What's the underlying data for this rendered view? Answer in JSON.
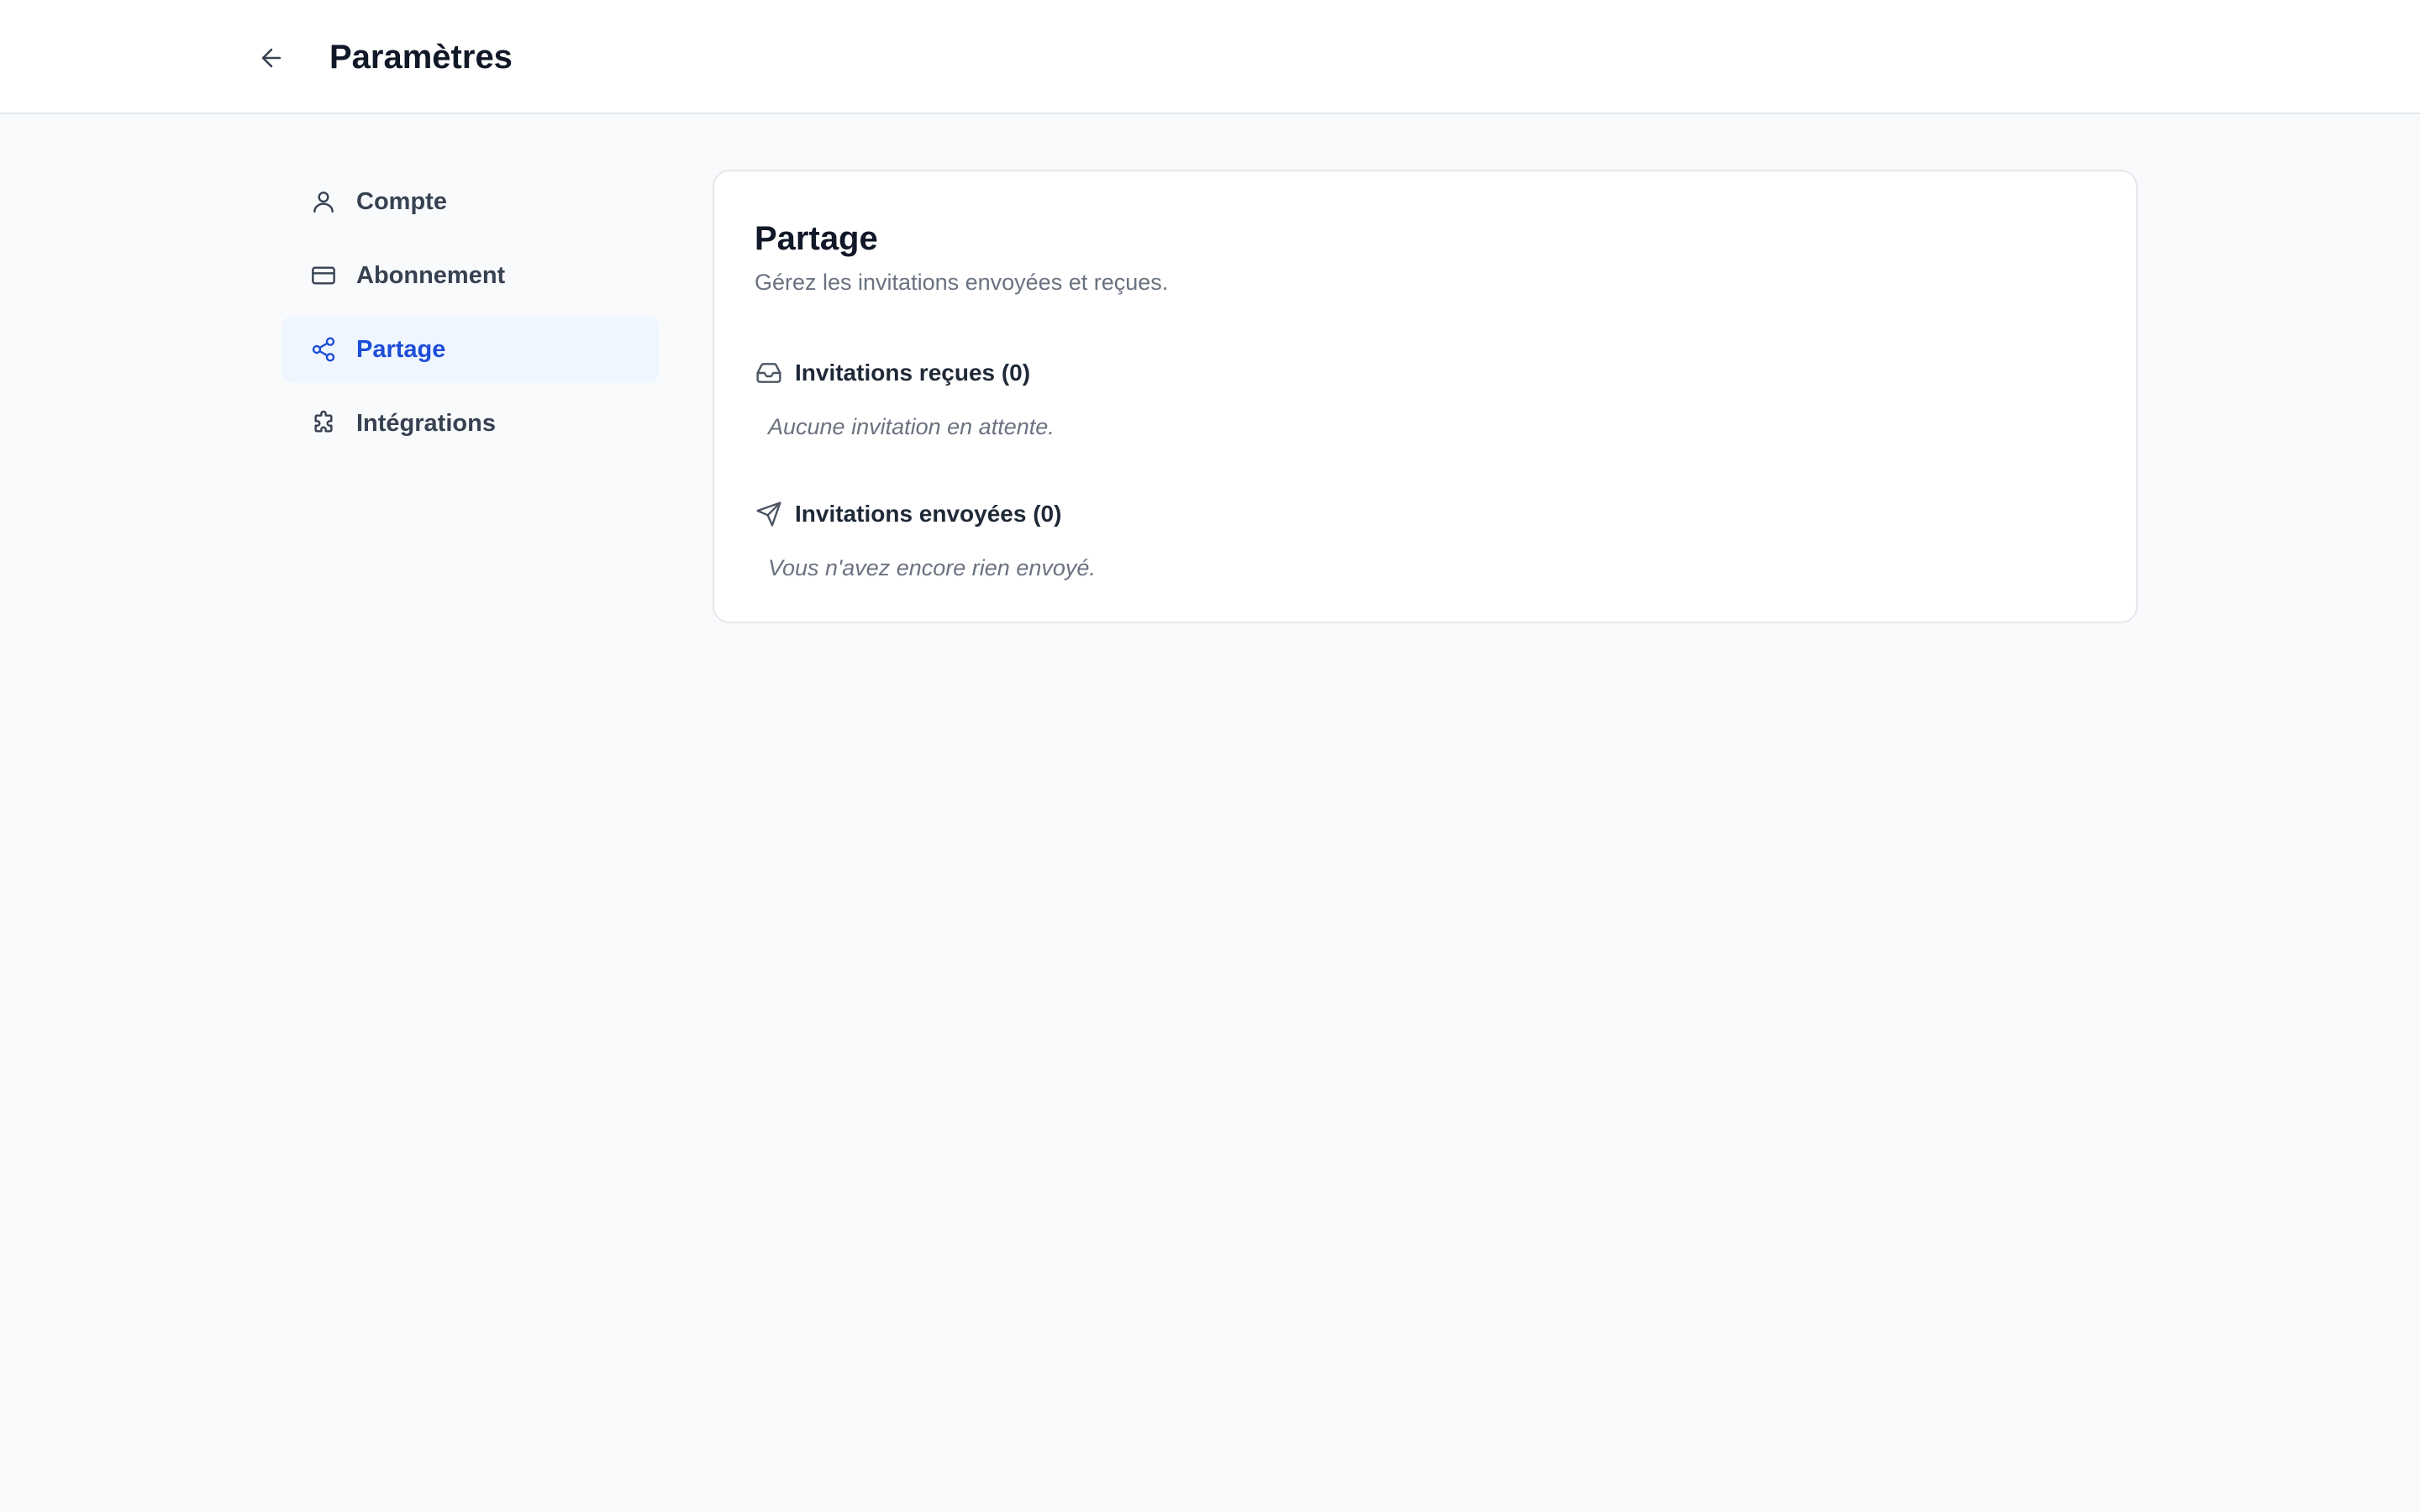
{
  "header": {
    "back_icon": "arrow-left-icon",
    "title": "Paramètres"
  },
  "sidebar": {
    "items": [
      {
        "label": "Compte",
        "icon": "user-icon",
        "active": false
      },
      {
        "label": "Abonnement",
        "icon": "credit-card-icon",
        "active": false
      },
      {
        "label": "Partage",
        "icon": "share-icon",
        "active": true
      },
      {
        "label": "Intégrations",
        "icon": "puzzle-icon",
        "active": false
      }
    ]
  },
  "main": {
    "title": "Partage",
    "subtitle": "Gérez les invitations envoyées et reçues.",
    "sections": [
      {
        "icon": "inbox-icon",
        "title": "Invitations reçues (0)",
        "empty_text": "Aucune invitation en attente."
      },
      {
        "icon": "send-icon",
        "title": "Invitations envoyées (0)",
        "empty_text": "Vous n'avez encore rien envoyé."
      }
    ]
  },
  "colors": {
    "accent": "#1d4ed8",
    "active_bg": "#eff6ff",
    "page_bg": "#f8fafc"
  }
}
